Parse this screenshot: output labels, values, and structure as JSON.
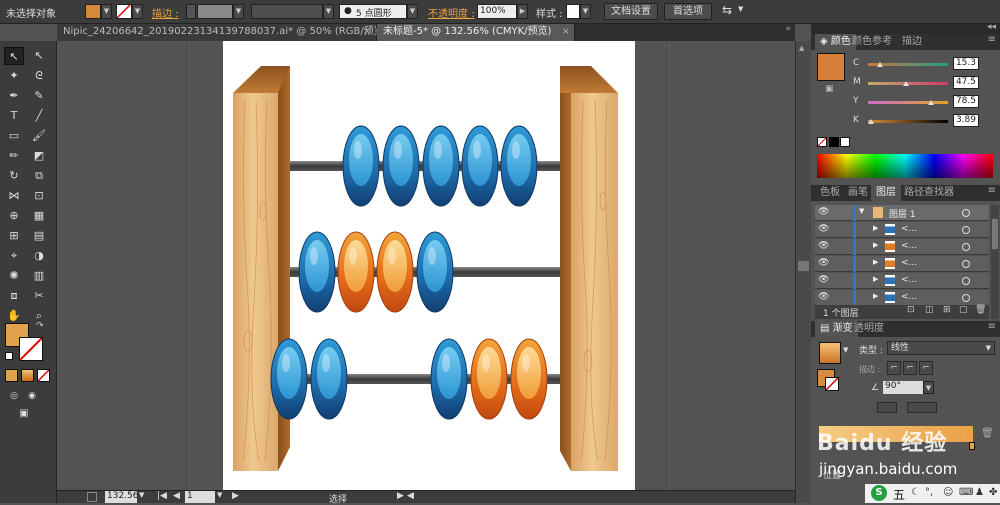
{
  "control_bar": {
    "no_selection": "未选择对象",
    "stroke_label": "描边",
    "stroke_weight_label": "描边 :",
    "brush_value": "5 点圆形",
    "opacity_label": "不透明度 :",
    "opacity_value": "100%",
    "style_label": "样式 :",
    "doc_settings": "文档设置",
    "preferences": "首选项"
  },
  "tabs": [
    {
      "label": "Nipic_24206642_20190223134139788037.ai* @ 50% (RGB/预览)"
    },
    {
      "label": "未标题-5* @ 132.56% (CMYK/预览)"
    }
  ],
  "color_panel": {
    "tabs": [
      "颜色",
      "颜色参考",
      "描边"
    ],
    "swatch": "#d57f38",
    "channels": [
      {
        "name": "C",
        "value": "15.3",
        "pct": 0.153,
        "gradient": "linear-gradient(90deg,#d07838,#1f9e8c)"
      },
      {
        "name": "M",
        "value": "47.5",
        "pct": 0.475,
        "gradient": "linear-gradient(90deg,#c4ad6c,#d03a6c)"
      },
      {
        "name": "Y",
        "value": "78.5",
        "pct": 0.785,
        "gradient": "linear-gradient(90deg,#cf6cc9,#e5a225)"
      },
      {
        "name": "K",
        "value": "3.89",
        "pct": 0.039,
        "gradient": "linear-gradient(90deg,#d98b3b,#000)"
      }
    ]
  },
  "layers_panel": {
    "tabs": [
      "色板",
      "画笔",
      "图层",
      "路径查找器"
    ],
    "layer_name": "图层 1",
    "rows": [
      {
        "name": "<...",
        "color": "#2b73b5"
      },
      {
        "name": "<...",
        "color": "#e07b28"
      },
      {
        "name": "<...",
        "color": "#e07b28"
      },
      {
        "name": "<...",
        "color": "#2b73b5"
      },
      {
        "name": "<...",
        "color": "#2b73b5"
      }
    ],
    "count": "1 个图层"
  },
  "gradient_panel": {
    "tabs": [
      "渐变",
      "透明度"
    ],
    "type_label": "类型 :",
    "type_value": "线性",
    "stroke_label": "描边 :",
    "angle_value": "90°",
    "location_label": "位置"
  },
  "status": {
    "zoom": "132.56",
    "page": "1",
    "mode": "选择"
  },
  "watermark": {
    "text1": "Baidu 经验",
    "text2": "jingyan.baidu.com"
  },
  "taskbar": {
    "ime_label": "五"
  },
  "colors": {
    "blue_bead": "#1f6fb2",
    "orange_bead": "#e3731f",
    "wood": "#e3b27a"
  },
  "abacus": {
    "rows": [
      {
        "beads": [
          "blue",
          "blue",
          "blue",
          "blue",
          "blue"
        ],
        "side": "right"
      },
      {
        "beads": [
          "blue",
          "orange",
          "orange",
          "blue"
        ],
        "side": "left"
      },
      {
        "beads": [
          "blue",
          "blue",
          "gap",
          "blue",
          "orange",
          "orange"
        ],
        "side": "both"
      }
    ]
  }
}
